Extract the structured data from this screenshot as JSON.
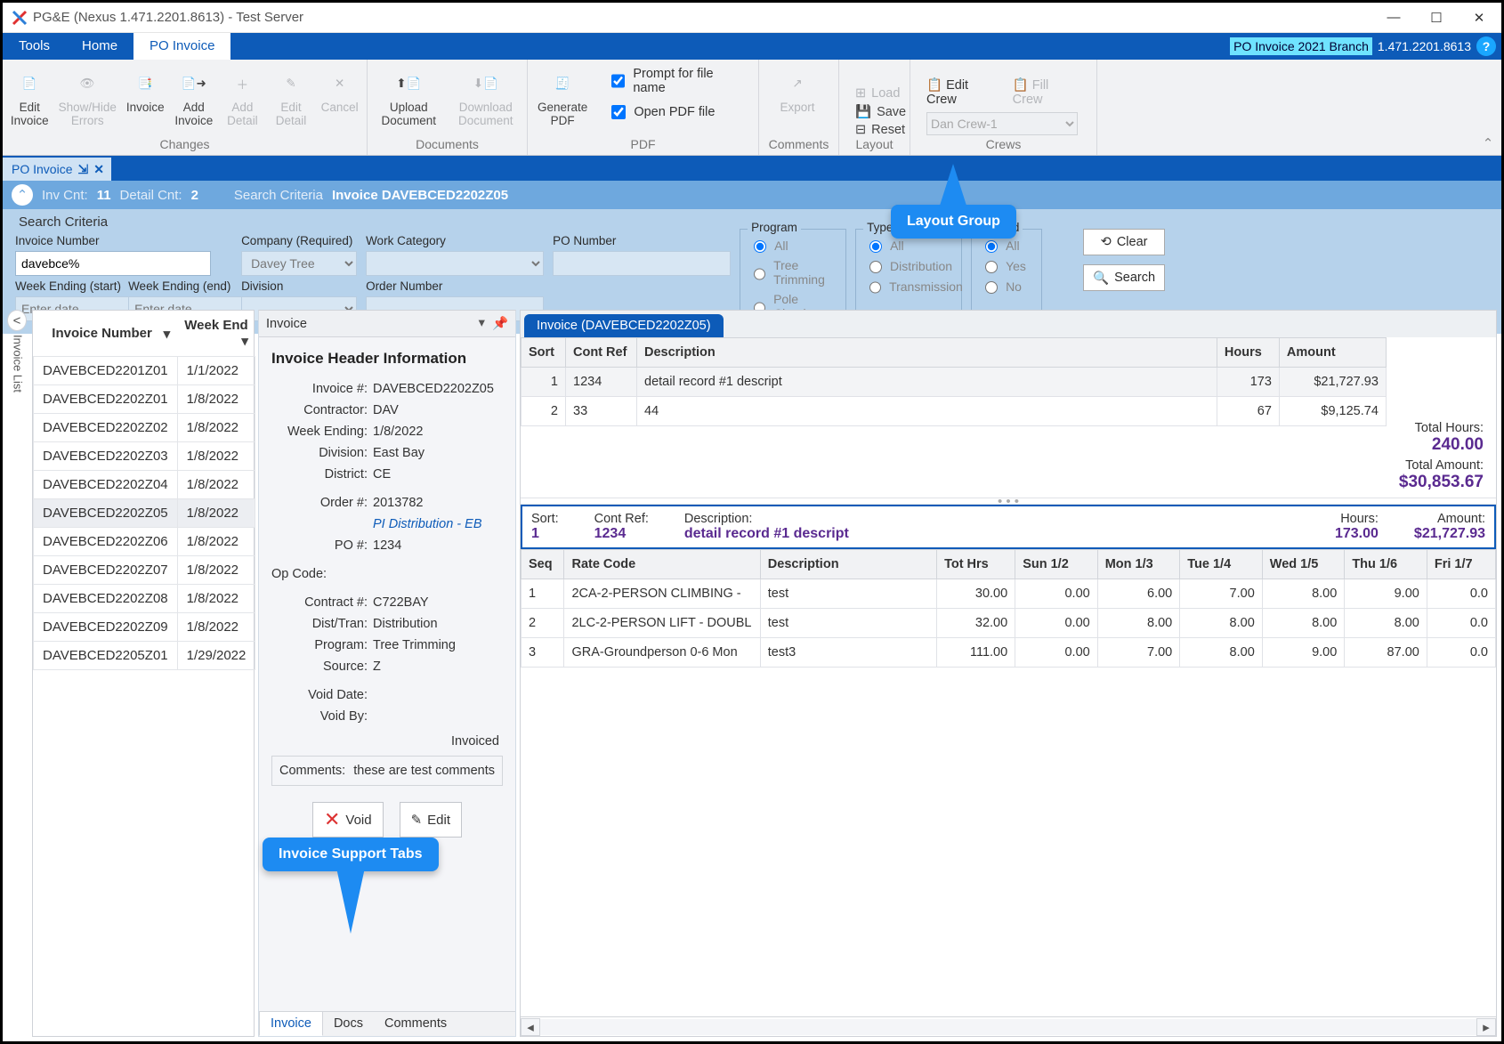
{
  "window": {
    "title": "PG&E (Nexus 1.471.2201.8613) - Test Server"
  },
  "menubar": {
    "tools": "Tools",
    "home": "Home",
    "poinvoice": "PO Invoice",
    "branch": "PO Invoice 2021 Branch",
    "ver": "1.471.2201.8613"
  },
  "ribbon": {
    "changes": {
      "label": "Changes",
      "edit_invoice": "Edit\nInvoice",
      "showhide": "Show/Hide\nErrors",
      "invoice": "Invoice",
      "add_invoice": "Add\nInvoice",
      "add_detail": "Add\nDetail",
      "edit_detail": "Edit\nDetail",
      "cancel": "Cancel"
    },
    "documents": {
      "label": "Documents",
      "upload": "Upload\nDocument",
      "download": "Download\nDocument"
    },
    "pdf": {
      "label": "PDF",
      "generate": "Generate\nPDF",
      "prompt": "Prompt for file name",
      "open": "Open PDF file"
    },
    "comments": {
      "label": "Comments",
      "export": "Export"
    },
    "layout": {
      "label": "Layout",
      "load": "Load",
      "save": "Save",
      "reset": "Reset"
    },
    "crews": {
      "label": "Crews",
      "edit": "Edit Crew",
      "fill": "Fill Crew",
      "selected": "Dan Crew-1"
    }
  },
  "doctab": {
    "label": "PO Invoice"
  },
  "summary": {
    "invcnt_lbl": "Inv Cnt:",
    "invcnt": "11",
    "detcnt_lbl": "Detail Cnt:",
    "detcnt": "2",
    "sc_lbl": "Search Criteria",
    "sc_val": "Invoice DAVEBCED2202Z05"
  },
  "criteria": {
    "title": "Search Criteria",
    "invnum_lbl": "Invoice Number",
    "invnum": "davebce%",
    "company_lbl": "Company (Required)",
    "company": "Davey Tree",
    "workcat_lbl": "Work Category",
    "workcat": "",
    "ponum_lbl": "PO Number",
    "ponum": "",
    "wes_lbl": "Week Ending (start)",
    "wes_ph": "Enter date",
    "wee_lbl": "Week Ending (end)",
    "wee_ph": "Enter date",
    "division_lbl": "Division",
    "division": "",
    "ordernum_lbl": "Order Number",
    "ordernum": "",
    "program": {
      "title": "Program",
      "all": "All",
      "tt": "Tree Trimming",
      "pc": "Pole Clearing"
    },
    "type": {
      "title": "Type",
      "all": "All",
      "dist": "Distribution",
      "trans": "Transmission"
    },
    "voided": {
      "title": "Voided",
      "all": "All",
      "yes": "Yes",
      "no": "No"
    },
    "clear": "Clear",
    "search": "Search"
  },
  "callouts": {
    "layout": "Layout Group",
    "support": "Invoice Support Tabs"
  },
  "sidebar": {
    "label": "Invoice List"
  },
  "invlist": {
    "col_num": "Invoice Number",
    "col_we": "Week End",
    "rows": [
      {
        "num": "DAVEBCED2201Z01",
        "we": "1/1/2022"
      },
      {
        "num": "DAVEBCED2202Z01",
        "we": "1/8/2022"
      },
      {
        "num": "DAVEBCED2202Z02",
        "we": "1/8/2022"
      },
      {
        "num": "DAVEBCED2202Z03",
        "we": "1/8/2022"
      },
      {
        "num": "DAVEBCED2202Z04",
        "we": "1/8/2022"
      },
      {
        "num": "DAVEBCED2202Z05",
        "we": "1/8/2022"
      },
      {
        "num": "DAVEBCED2202Z06",
        "we": "1/8/2022"
      },
      {
        "num": "DAVEBCED2202Z07",
        "we": "1/8/2022"
      },
      {
        "num": "DAVEBCED2202Z08",
        "we": "1/8/2022"
      },
      {
        "num": "DAVEBCED2202Z09",
        "we": "1/8/2022"
      },
      {
        "num": "DAVEBCED2205Z01",
        "we": "1/29/2022"
      }
    ]
  },
  "header": {
    "panel_title": "Invoice",
    "section": "Invoice Header Information",
    "invoice_num_lbl": "Invoice #:",
    "invoice_num": "DAVEBCED2202Z05",
    "contractor_lbl": "Contractor:",
    "contractor": "DAV",
    "weekending_lbl": "Week Ending:",
    "weekending": "1/8/2022",
    "division_lbl": "Division:",
    "division": "East Bay",
    "district_lbl": "District:",
    "district": "CE",
    "order_lbl": "Order #:",
    "order": "2013782",
    "pi": "PI Distribution - EB",
    "po_lbl": "PO #:",
    "po": "1234",
    "opcode_lbl": "Op Code:",
    "contract_lbl": "Contract #:",
    "contract": "C722BAY",
    "disttran_lbl": "Dist/Tran:",
    "disttran": "Distribution",
    "program_lbl": "Program:",
    "program": "Tree Trimming",
    "source_lbl": "Source:",
    "source": "Z",
    "voiddate_lbl": "Void Date:",
    "voidby_lbl": "Void By:",
    "invoiced_lbl": "Invoiced",
    "comments_lbl": "Comments:",
    "comments": "these are test comments",
    "void": "Void",
    "edit": "Edit",
    "tabs": {
      "invoice": "Invoice",
      "docs": "Docs",
      "comments": "Comments"
    }
  },
  "detail": {
    "tab": "Invoice (DAVEBCED2202Z05)",
    "totals": {
      "th_lbl": "Total Hours:",
      "th": "240.00",
      "ta_lbl": "Total Amount:",
      "ta": "$30,853.67"
    },
    "cols": {
      "sort": "Sort",
      "contref": "Cont Ref",
      "desc": "Description",
      "hours": "Hours",
      "amount": "Amount"
    },
    "rows": [
      {
        "sort": "1",
        "contref": "1234",
        "desc": "detail record #1 descript",
        "hours": "173",
        "amount": "$21,727.93"
      },
      {
        "sort": "2",
        "contref": "33",
        "desc": "44",
        "hours": "67",
        "amount": "$9,125.74"
      }
    ]
  },
  "subdetail": {
    "hdr": {
      "sort_lbl": "Sort:",
      "sort": "1",
      "contref_lbl": "Cont Ref:",
      "contref": "1234",
      "desc_lbl": "Description:",
      "desc": "detail record #1 descript",
      "hours_lbl": "Hours:",
      "hours": "173.00",
      "amount_lbl": "Amount:",
      "amount": "$21,727.93"
    },
    "cols": {
      "seq": "Seq",
      "rate": "Rate Code",
      "desc": "Description",
      "tot": "Tot Hrs",
      "d1": "Sun 1/2",
      "d2": "Mon 1/3",
      "d3": "Tue 1/4",
      "d4": "Wed 1/5",
      "d5": "Thu 1/6",
      "d6": "Fri 1/7"
    },
    "rows": [
      {
        "seq": "1",
        "rate": "2CA-2-PERSON CLIMBING -",
        "desc": "test",
        "tot": "30.00",
        "d1": "0.00",
        "d2": "6.00",
        "d3": "7.00",
        "d4": "8.00",
        "d5": "9.00",
        "d6": "0.0"
      },
      {
        "seq": "2",
        "rate": "2LC-2-PERSON LIFT - DOUBL",
        "desc": "test",
        "tot": "32.00",
        "d1": "0.00",
        "d2": "8.00",
        "d3": "8.00",
        "d4": "8.00",
        "d5": "8.00",
        "d6": "0.0"
      },
      {
        "seq": "3",
        "rate": "GRA-Groundperson 0-6 Mon",
        "desc": "test3",
        "tot": "111.00",
        "d1": "0.00",
        "d2": "7.00",
        "d3": "8.00",
        "d4": "9.00",
        "d5": "87.00",
        "d6": "0.0"
      }
    ]
  }
}
